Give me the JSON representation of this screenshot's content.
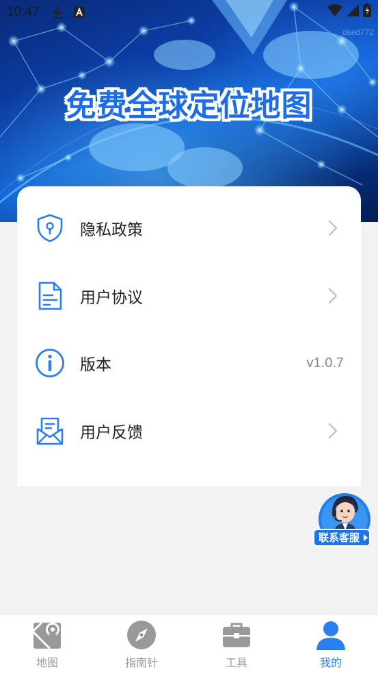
{
  "status_bar": {
    "time": "10:47",
    "icons_left": [
      "download-icon",
      "a-badge-icon"
    ],
    "icons_right": [
      "wifi-icon",
      "signal-icon",
      "battery-icon"
    ]
  },
  "banner": {
    "title": "免费全球定位地图",
    "watermark": "dsed772"
  },
  "menu": {
    "items": [
      {
        "label": "隐私政策",
        "icon": "shield-lock-icon",
        "chevron": true
      },
      {
        "label": "用户协议",
        "icon": "document-icon",
        "chevron": true
      },
      {
        "label": "版本",
        "icon": "info-icon",
        "value": "v1.0.7",
        "chevron": false
      },
      {
        "label": "用户反馈",
        "icon": "mail-feedback-icon",
        "chevron": true
      }
    ]
  },
  "customer_service": {
    "label": "联系客服"
  },
  "bottom_nav": {
    "items": [
      {
        "label": "地图",
        "icon": "map-icon",
        "active": false
      },
      {
        "label": "指南针",
        "icon": "compass-icon",
        "active": false
      },
      {
        "label": "工具",
        "icon": "toolbox-icon",
        "active": false
      },
      {
        "label": "我的",
        "icon": "user-icon",
        "active": true
      }
    ]
  },
  "colors": {
    "accent": "#2b7ef0",
    "inactive": "#999999",
    "banner_dark": "#0a2a7a",
    "background": "#f2f2f2"
  }
}
